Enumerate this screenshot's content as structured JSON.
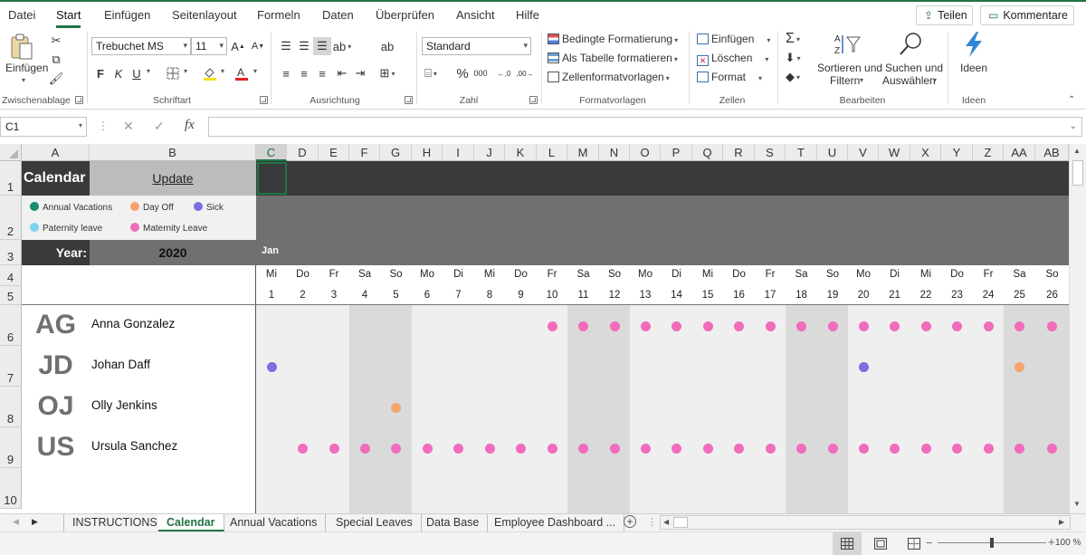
{
  "menu": {
    "items": [
      "Datei",
      "Start",
      "Einfügen",
      "Seitenlayout",
      "Formeln",
      "Daten",
      "Überprüfen",
      "Ansicht",
      "Hilfe"
    ],
    "active_index": 1,
    "share_label": "Teilen",
    "comments_label": "Kommentare"
  },
  "ribbon": {
    "clipboard": {
      "paste_label": "Einfügen",
      "group_label": "Zwischenablage"
    },
    "font": {
      "font_name": "Trebuchet MS",
      "font_size": "11",
      "bold": "F",
      "italic": "K",
      "underline": "U",
      "group_label": "Schriftart"
    },
    "alignment": {
      "group_label": "Ausrichtung"
    },
    "number": {
      "format": "Standard",
      "group_label": "Zahl"
    },
    "styles": {
      "conditional": "Bedingte Formatierung",
      "as_table": "Als Tabelle formatieren",
      "cell_styles": "Zellenformatvorlagen",
      "group_label": "Formatvorlagen"
    },
    "cells": {
      "insert": "Einfügen",
      "delete": "Löschen",
      "format": "Format",
      "group_label": "Zellen"
    },
    "editing": {
      "sort_line1": "Sortieren und",
      "sort_line2": "Filtern",
      "find_line1": "Suchen und",
      "find_line2": "Auswählen",
      "group_label": "Bearbeiten"
    },
    "ideas": {
      "label": "Ideen",
      "group_label": "Ideen"
    }
  },
  "formula_bar": {
    "name_box": "C1",
    "fx": "fx",
    "formula": ""
  },
  "columns": [
    "A",
    "B",
    "C",
    "D",
    "E",
    "F",
    "G",
    "H",
    "I",
    "J",
    "K",
    "L",
    "M",
    "N",
    "O",
    "P",
    "Q",
    "R",
    "S",
    "T",
    "U",
    "V",
    "W",
    "X",
    "Y",
    "Z",
    "AA",
    "AB"
  ],
  "selected_column": "C",
  "rows": [
    "1",
    "2",
    "3",
    "4",
    "5",
    "6",
    "7",
    "8",
    "9",
    "10"
  ],
  "calendar": {
    "title": "Calendar",
    "update_label": "Update",
    "year_label": "Year:",
    "year_value": "2020",
    "month_label": "Jan",
    "legend": [
      {
        "label": "Annual Vacations",
        "color": "#1a8a72"
      },
      {
        "label": "Day Off",
        "color": "#f4a46e"
      },
      {
        "label": "Sick",
        "color": "#7a6fe0"
      },
      {
        "label": "Paternity leave",
        "color": "#7fd3f0"
      },
      {
        "label": "Maternity Leave",
        "color": "#f06cbc"
      }
    ],
    "weekdays": [
      "Mi",
      "Do",
      "Fr",
      "Sa",
      "So",
      "Mo",
      "Di",
      "Mi",
      "Do",
      "Fr",
      "Sa",
      "So",
      "Mo",
      "Di",
      "Mi",
      "Do",
      "Fr",
      "Sa",
      "So",
      "Mo",
      "Di",
      "Mi",
      "Do",
      "Fr",
      "Sa",
      "So"
    ],
    "days": [
      "1",
      "2",
      "3",
      "4",
      "5",
      "6",
      "7",
      "8",
      "9",
      "10",
      "11",
      "12",
      "13",
      "14",
      "15",
      "16",
      "17",
      "18",
      "19",
      "20",
      "21",
      "22",
      "23",
      "24",
      "25",
      "26"
    ],
    "weekend_day_indices": [
      3,
      4,
      10,
      11,
      17,
      18,
      24,
      25
    ],
    "employees": [
      {
        "initials": "AG",
        "name": "Anna Gonzalez",
        "leaves": [
          {
            "day": 10,
            "type": "Maternity Leave"
          },
          {
            "day": 11,
            "type": "Maternity Leave"
          },
          {
            "day": 12,
            "type": "Maternity Leave"
          },
          {
            "day": 13,
            "type": "Maternity Leave"
          },
          {
            "day": 14,
            "type": "Maternity Leave"
          },
          {
            "day": 15,
            "type": "Maternity Leave"
          },
          {
            "day": 16,
            "type": "Maternity Leave"
          },
          {
            "day": 17,
            "type": "Maternity Leave"
          },
          {
            "day": 18,
            "type": "Maternity Leave"
          },
          {
            "day": 19,
            "type": "Maternity Leave"
          },
          {
            "day": 20,
            "type": "Maternity Leave"
          },
          {
            "day": 21,
            "type": "Maternity Leave"
          },
          {
            "day": 22,
            "type": "Maternity Leave"
          },
          {
            "day": 23,
            "type": "Maternity Leave"
          },
          {
            "day": 24,
            "type": "Maternity Leave"
          },
          {
            "day": 25,
            "type": "Maternity Leave"
          },
          {
            "day": 26,
            "type": "Maternity Leave"
          }
        ]
      },
      {
        "initials": "JD",
        "name": "Johan Daff",
        "leaves": [
          {
            "day": 1,
            "type": "Sick"
          },
          {
            "day": 20,
            "type": "Sick"
          },
          {
            "day": 25,
            "type": "Day Off"
          }
        ]
      },
      {
        "initials": "OJ",
        "name": "Olly Jenkins",
        "leaves": [
          {
            "day": 5,
            "type": "Day Off"
          }
        ]
      },
      {
        "initials": "US",
        "name": "Ursula Sanchez",
        "leaves": [
          {
            "day": 2,
            "type": "Maternity Leave"
          },
          {
            "day": 3,
            "type": "Maternity Leave"
          },
          {
            "day": 4,
            "type": "Maternity Leave"
          },
          {
            "day": 5,
            "type": "Maternity Leave"
          },
          {
            "day": 6,
            "type": "Maternity Leave"
          },
          {
            "day": 7,
            "type": "Maternity Leave"
          },
          {
            "day": 8,
            "type": "Maternity Leave"
          },
          {
            "day": 9,
            "type": "Maternity Leave"
          },
          {
            "day": 10,
            "type": "Maternity Leave"
          },
          {
            "day": 11,
            "type": "Maternity Leave"
          },
          {
            "day": 12,
            "type": "Maternity Leave"
          },
          {
            "day": 13,
            "type": "Maternity Leave"
          },
          {
            "day": 14,
            "type": "Maternity Leave"
          },
          {
            "day": 15,
            "type": "Maternity Leave"
          },
          {
            "day": 16,
            "type": "Maternity Leave"
          },
          {
            "day": 17,
            "type": "Maternity Leave"
          },
          {
            "day": 18,
            "type": "Maternity Leave"
          },
          {
            "day": 19,
            "type": "Maternity Leave"
          },
          {
            "day": 20,
            "type": "Maternity Leave"
          },
          {
            "day": 21,
            "type": "Maternity Leave"
          },
          {
            "day": 22,
            "type": "Maternity Leave"
          },
          {
            "day": 23,
            "type": "Maternity Leave"
          },
          {
            "day": 24,
            "type": "Maternity Leave"
          },
          {
            "day": 25,
            "type": "Maternity Leave"
          },
          {
            "day": 26,
            "type": "Maternity Leave"
          }
        ]
      }
    ]
  },
  "sheets": {
    "tabs": [
      "INSTRUCTIONS",
      "Calendar",
      "Annual Vacations",
      "Special Leaves",
      "Data Base",
      "Employee Dashboard ..."
    ],
    "active_index": 1
  },
  "status": {
    "zoom": "100 %",
    "zoom_level_percent": 100
  },
  "colors": {
    "accent": "#217346",
    "header_dark": "#3a3a3a",
    "band_gray": "#707070",
    "weekend_fill": "#dadada",
    "weekday_fill": "#efefef"
  }
}
